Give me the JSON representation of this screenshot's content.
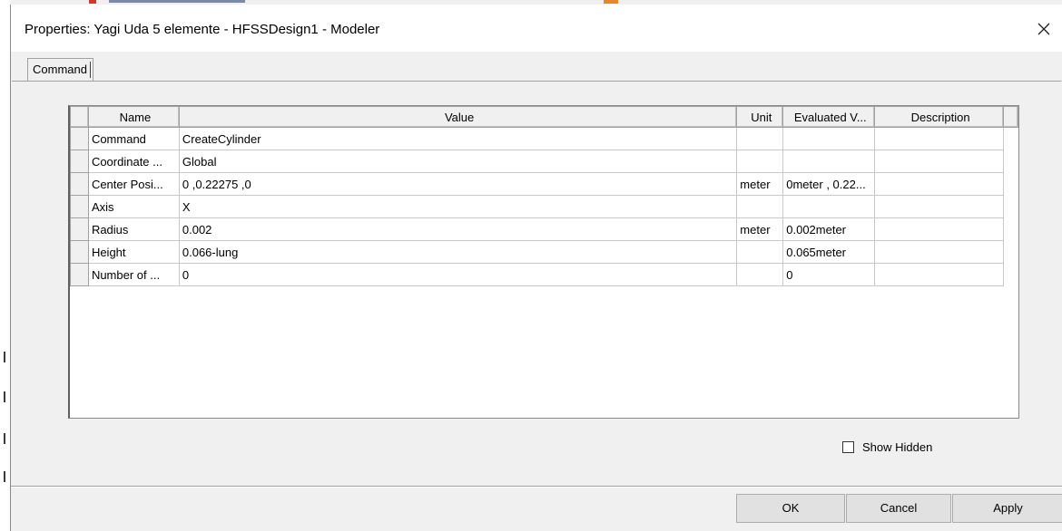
{
  "dialog": {
    "title": "Properties: Yagi Uda 5 elemente - HFSSDesign1 - Modeler",
    "close_icon": "close-icon"
  },
  "tabs": [
    {
      "label": "Command",
      "selected": true
    }
  ],
  "grid": {
    "columns": [
      "Name",
      "Value",
      "Unit",
      "Evaluated V...",
      "Description"
    ],
    "rows": [
      {
        "name": "Command",
        "value": "CreateCylinder",
        "unit": "",
        "evaluated": "",
        "description": ""
      },
      {
        "name": "Coordinate ...",
        "value": "Global",
        "unit": "",
        "evaluated": "",
        "description": ""
      },
      {
        "name": "Center Posi...",
        "value": "0 ,0.22275 ,0",
        "unit": "meter",
        "evaluated": "0meter , 0.22...",
        "description": ""
      },
      {
        "name": "Axis",
        "value": "X",
        "unit": "",
        "evaluated": "",
        "description": ""
      },
      {
        "name": "Radius",
        "value": "0.002",
        "unit": "meter",
        "evaluated": "0.002meter",
        "description": ""
      },
      {
        "name": "Height",
        "value": "0.066-lung",
        "unit": "",
        "evaluated": "0.065meter",
        "description": ""
      },
      {
        "name": "Number of ...",
        "value": "0",
        "unit": "",
        "evaluated": "0",
        "description": ""
      }
    ]
  },
  "show_hidden": {
    "label": "Show Hidden",
    "checked": false
  },
  "buttons": {
    "ok": "OK",
    "cancel": "Cancel",
    "apply": "Apply"
  }
}
